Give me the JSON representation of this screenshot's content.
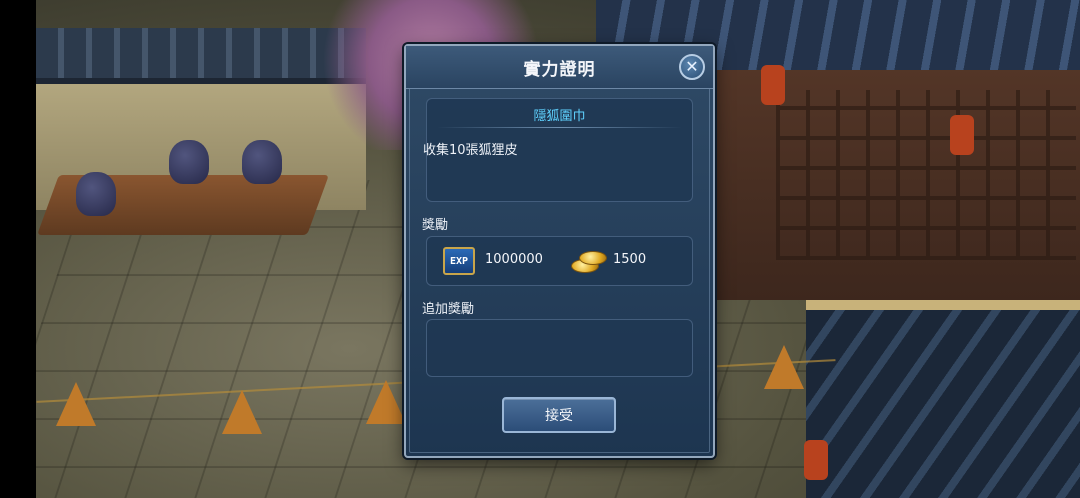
{
  "dialog": {
    "title": "實力證明",
    "quest_name": "隱狐圍巾",
    "quest_description": "收集10張狐狸皮",
    "reward_label": "獎勵",
    "rewards": {
      "exp_icon_text": "EXP",
      "exp_value": "1000000",
      "gold_value": "1500"
    },
    "extra_reward_label": "追加獎勵",
    "accept_label": "接受",
    "close_icon": "close-icon"
  },
  "colors": {
    "accent_quest_name": "#5fd2ff",
    "dialog_bg": "#1d3550",
    "dialog_border": "#93a7bd"
  }
}
